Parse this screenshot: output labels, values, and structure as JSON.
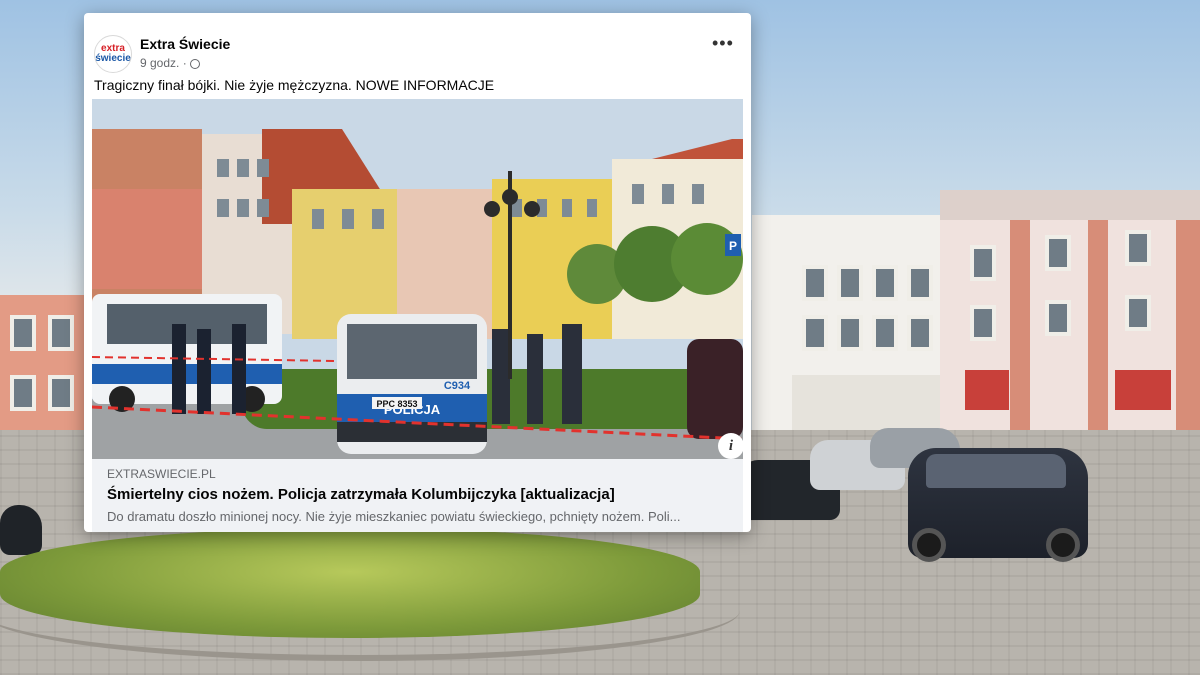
{
  "post": {
    "page_name": "Extra Świecie",
    "avatar_text": [
      "extra",
      "świecie"
    ],
    "time": "9 godz. ·",
    "more_label": "•••",
    "text": "Tragiczny finał bójki. Nie żyje mężczyzna. NOWE INFORMACJE",
    "info_label": "i"
  },
  "link_preview": {
    "domain": "EXTRASWIECIE.PL",
    "title": "Śmiertelny cios nożem. Policja zatrzymała Kolumbijczyka [aktualizacja]",
    "description": "Do dramatu doszło minionej nocy. Nie żyje mieszkaniec powiatu świeckiego, pchnięty nożem. Poli..."
  },
  "photo": {
    "van_label": "POLICJA",
    "van_plate": "PPC 8353",
    "van_number": "C934"
  },
  "colors": {
    "brand_red": "#d62027",
    "brand_blue": "#1a57a6",
    "police_blue": "#1f5fb0"
  }
}
